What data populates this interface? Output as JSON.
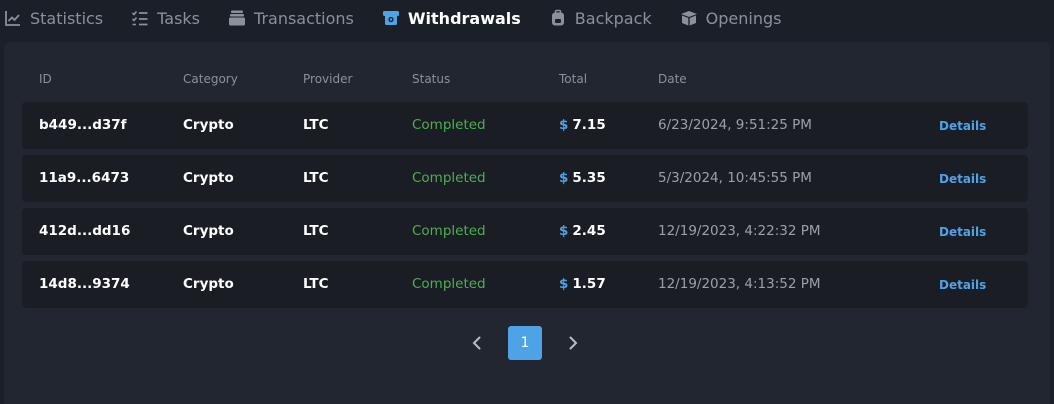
{
  "tabs": [
    {
      "label": "Statistics",
      "icon": "chart-line-icon",
      "active": false
    },
    {
      "label": "Tasks",
      "icon": "checklist-icon",
      "active": false
    },
    {
      "label": "Transactions",
      "icon": "stack-icon",
      "active": false
    },
    {
      "label": "Withdrawals",
      "icon": "atm-icon",
      "active": true
    },
    {
      "label": "Backpack",
      "icon": "backpack-icon",
      "active": false
    },
    {
      "label": "Openings",
      "icon": "box-open-icon",
      "active": false
    }
  ],
  "table": {
    "headers": {
      "id": "ID",
      "category": "Category",
      "provider": "Provider",
      "status": "Status",
      "total": "Total",
      "date": "Date"
    },
    "rows": [
      {
        "id": "b449...d37f",
        "category": "Crypto",
        "provider": "LTC",
        "status": "Completed",
        "currency": "$",
        "total": "7.15",
        "date": "6/23/2024, 9:51:25 PM",
        "details": "Details"
      },
      {
        "id": "11a9...6473",
        "category": "Crypto",
        "provider": "LTC",
        "status": "Completed",
        "currency": "$",
        "total": "5.35",
        "date": "5/3/2024, 10:45:55 PM",
        "details": "Details"
      },
      {
        "id": "412d...dd16",
        "category": "Crypto",
        "provider": "LTC",
        "status": "Completed",
        "currency": "$",
        "total": "2.45",
        "date": "12/19/2023, 4:22:32 PM",
        "details": "Details"
      },
      {
        "id": "14d8...9374",
        "category": "Crypto",
        "provider": "LTC",
        "status": "Completed",
        "currency": "$",
        "total": "1.57",
        "date": "12/19/2023, 4:13:52 PM",
        "details": "Details"
      }
    ]
  },
  "pagination": {
    "current_page": "1"
  },
  "colors": {
    "accent": "#4da3e6",
    "status_completed": "#4caf50",
    "background": "#1b1f28",
    "panel": "#222631",
    "row": "#1a1d24"
  }
}
